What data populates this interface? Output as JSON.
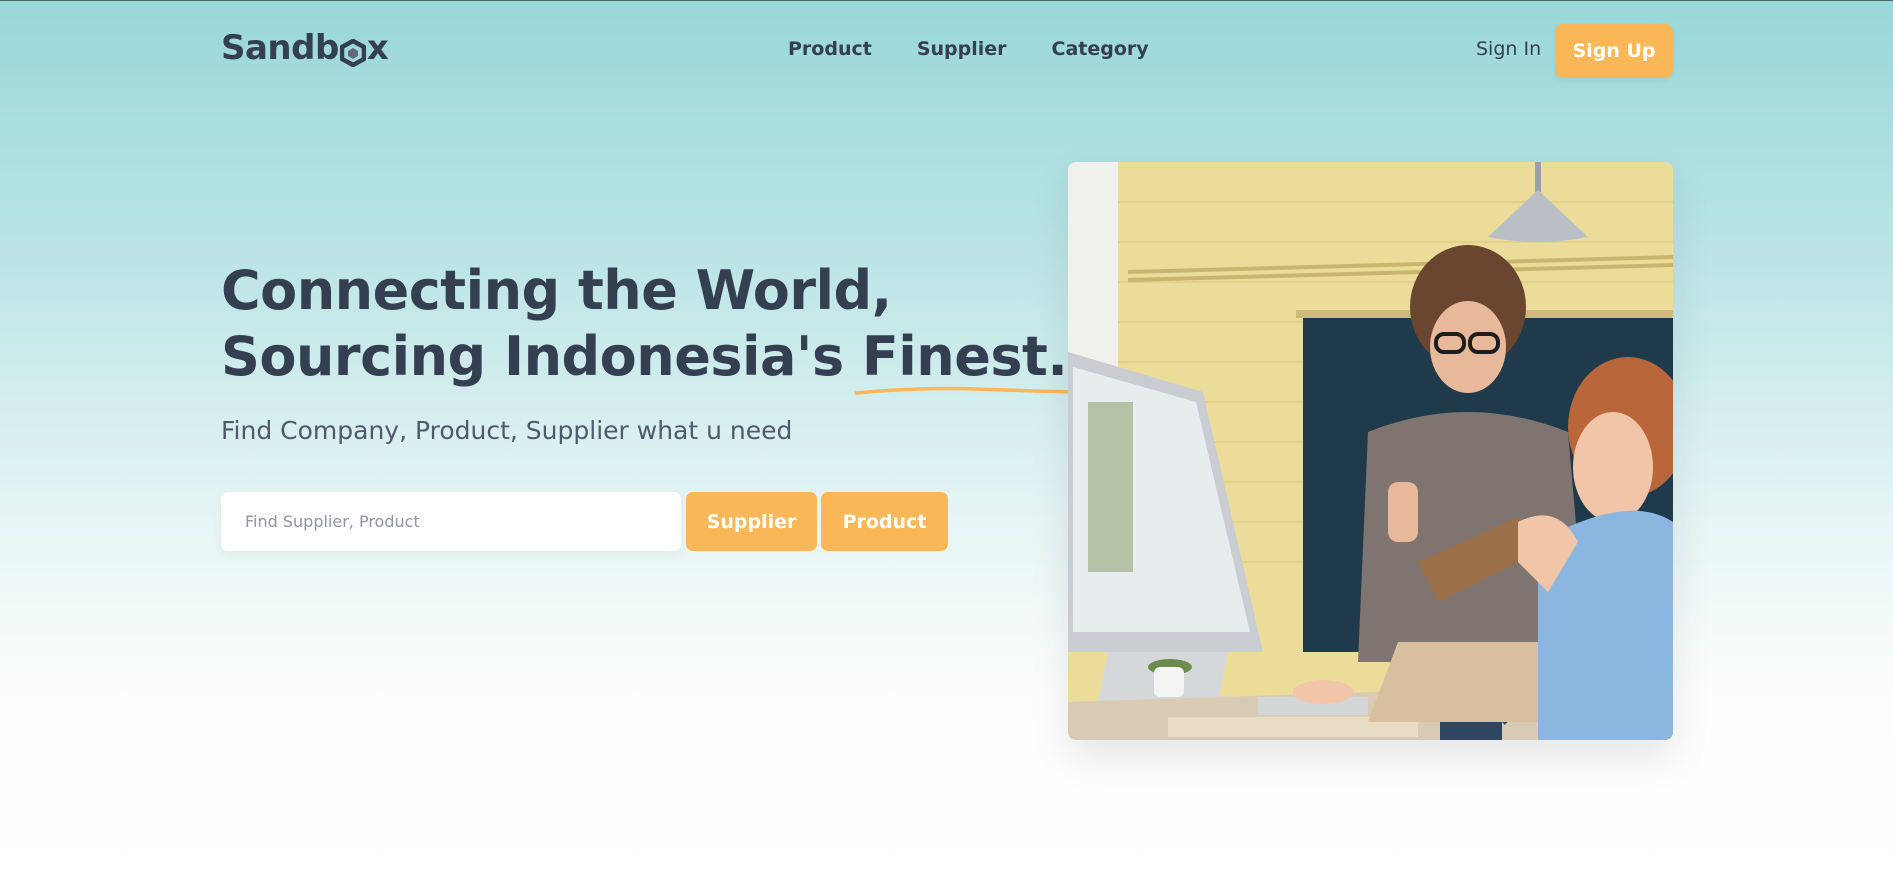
{
  "brand": {
    "name_prefix": "Sandb",
    "name_suffix": "x"
  },
  "nav": {
    "items": [
      {
        "label": "Product"
      },
      {
        "label": "Supplier"
      },
      {
        "label": "Category"
      }
    ]
  },
  "auth": {
    "signin_label": "Sign In",
    "signup_label": "Sign Up"
  },
  "hero": {
    "headline_line1": "Connecting the World,",
    "headline_line2_prefix": "Sourcing Indonesia's ",
    "headline_highlight": "Finest.",
    "subtitle": "Find Company, Product, Supplier what u need",
    "search_placeholder": "Find Supplier, Product",
    "search_value": "",
    "supplier_button": "Supplier",
    "product_button": "Product"
  },
  "colors": {
    "accent": "#fab758",
    "text": "#343f52",
    "background_top": "#9ad7d9"
  },
  "icons": {
    "logo_mark": "hexagon-icon"
  }
}
